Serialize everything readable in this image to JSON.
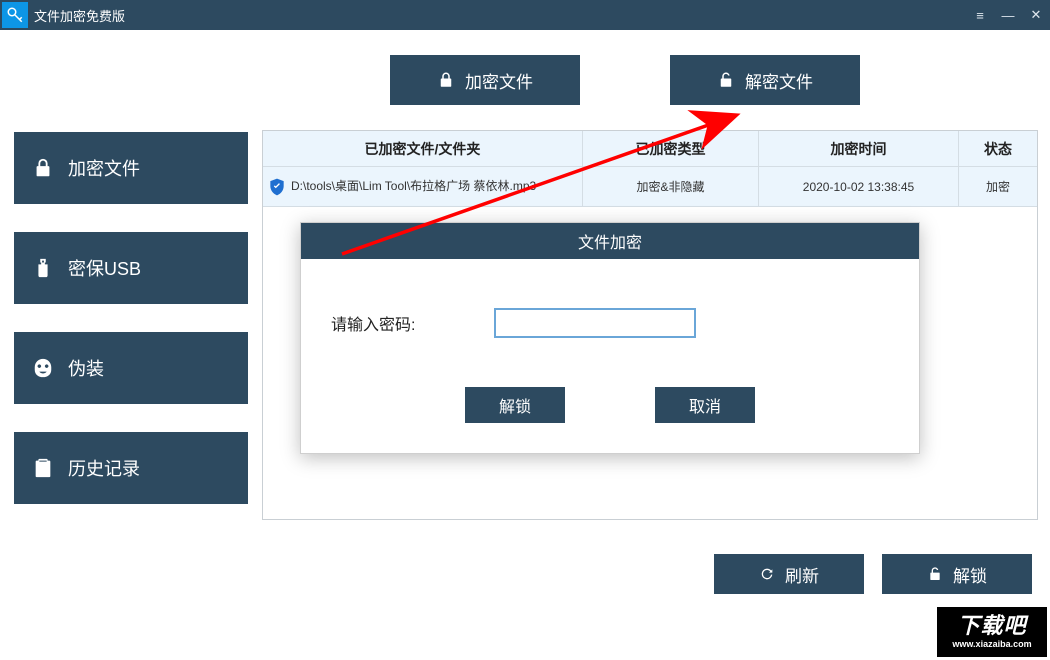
{
  "title": "文件加密免费版",
  "window_controls": {
    "menu": "≡",
    "minimize": "—",
    "close": "✕"
  },
  "top_buttons": {
    "encrypt_file": "加密文件",
    "decrypt_file": "解密文件"
  },
  "sidebar": {
    "encrypt_file": "加密文件",
    "usb": "密保USB",
    "disguise": "伪装",
    "history": "历史记录"
  },
  "table": {
    "headers": {
      "path": "已加密文件/文件夹",
      "type": "已加密类型",
      "time": "加密时间",
      "status": "状态"
    },
    "row0": {
      "path": "D:\\tools\\桌面\\Lim Tool\\布拉格广场  蔡依林.mp3",
      "type": "加密&非隐藏",
      "time": "2020-10-02 13:38:45",
      "status": "加密"
    }
  },
  "dialog": {
    "title": "文件加密",
    "password_label": "请输入密码:",
    "password_value": "",
    "unlock": "解锁",
    "cancel": "取消"
  },
  "bottom": {
    "refresh": "刷新",
    "unlock": "解锁"
  },
  "watermark": {
    "text": "下载吧",
    "url": "www.xiazaiba.com"
  }
}
